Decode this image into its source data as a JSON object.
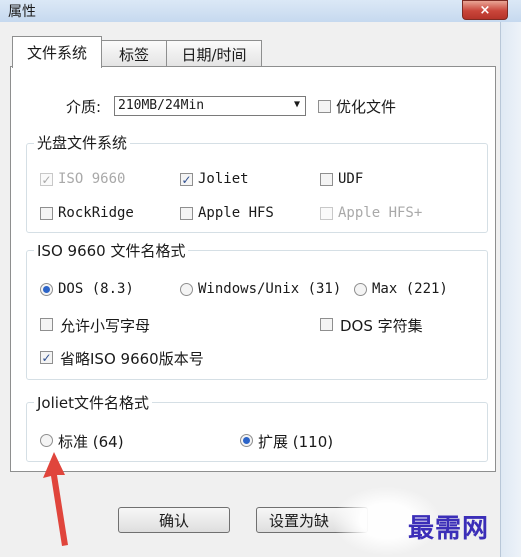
{
  "window": {
    "title": "属性",
    "close_glyph": "×"
  },
  "tabs": [
    {
      "label": "文件系统",
      "active": true
    },
    {
      "label": "标签",
      "active": false
    },
    {
      "label": "日期/时间",
      "active": false
    }
  ],
  "media": {
    "label": "介质:",
    "value": "210MB/24Min",
    "optimize_label": "优化文件",
    "optimize_checked": false
  },
  "disc_fs": {
    "legend": "光盘文件系统",
    "options": [
      {
        "label": "ISO 9660",
        "checked": true,
        "disabled": true
      },
      {
        "label": "Joliet",
        "checked": true,
        "disabled": false
      },
      {
        "label": "UDF",
        "checked": false,
        "disabled": false
      },
      {
        "label": "RockRidge",
        "checked": false,
        "disabled": false
      },
      {
        "label": "Apple HFS",
        "checked": false,
        "disabled": false
      },
      {
        "label": "Apple HFS+",
        "checked": false,
        "disabled": true
      }
    ]
  },
  "iso_names": {
    "legend": "ISO 9660 文件名格式",
    "radios": [
      {
        "label": "DOS (8.3)",
        "selected": true
      },
      {
        "label": "Windows/Unix (31)",
        "selected": false
      },
      {
        "label": "Max (221)",
        "selected": false
      }
    ],
    "allow_lowercase": "允许小写字母",
    "dos_charset": "DOS 字符集",
    "omit_version": "省略ISO 9660版本号",
    "omit_version_checked": true
  },
  "joliet_names": {
    "legend": "Joliet文件名格式",
    "radios": [
      {
        "label": "标准 (64)",
        "selected": false
      },
      {
        "label": "扩展 (110)",
        "selected": true
      }
    ]
  },
  "buttons": {
    "ok": "确认",
    "set_default": "设置为缺"
  },
  "watermark": "最需网",
  "colors": {
    "accent_radio": "#2c64c8",
    "annotation_arrow": "#e0453c",
    "watermark": "#3b2eb8"
  }
}
